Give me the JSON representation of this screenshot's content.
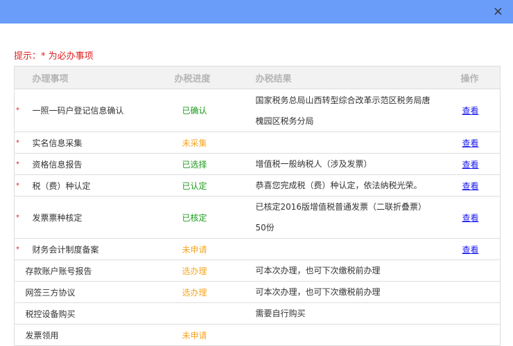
{
  "close_icon": "×",
  "hint": "提示：* 为必办事项",
  "headers": [
    "办理事项",
    "办税进度",
    "办税结果",
    "操作"
  ],
  "rows": [
    {
      "required": "*",
      "item": "一照一码户登记信息确认",
      "status": "已确认",
      "status_color": "green",
      "result": "国家税务总局山西转型综合改革示范区税务局唐槐园区税务分局",
      "action": "查看"
    },
    {
      "required": "*",
      "item": "实名信息采集",
      "status": "未采集",
      "status_color": "orange",
      "result": "",
      "action": "查看"
    },
    {
      "required": "*",
      "item": "资格信息报告",
      "status": "已选择",
      "status_color": "green",
      "result": "增值税一般纳税人（涉及发票）",
      "action": "查看"
    },
    {
      "required": "*",
      "item": "税（费）种认定",
      "status": "已认定",
      "status_color": "green",
      "result": "恭喜您完成税（费）种认定，依法纳税光荣。",
      "action": "查看"
    },
    {
      "required": "*",
      "item": "发票票种核定",
      "status": "已核定",
      "status_color": "green",
      "result": "已核定2016版增值税普通发票（二联折叠票）50份",
      "action": "查看"
    },
    {
      "required": "*",
      "item": "财务会计制度备案",
      "status": "未申请",
      "status_color": "orange",
      "result": "",
      "action": "查看"
    },
    {
      "required": "",
      "item": "存款账户账号报告",
      "status": "选办理",
      "status_color": "orange",
      "result": "可本次办理，也可下次缴税前办理",
      "action": ""
    },
    {
      "required": "",
      "item": "网签三方协议",
      "status": "选办理",
      "status_color": "orange",
      "result": "可本次办理，也可下次缴税前办理",
      "action": ""
    },
    {
      "required": "",
      "item": "税控设备购买",
      "status": "",
      "status_color": "",
      "result": "需要自行购买",
      "action": ""
    },
    {
      "required": "",
      "item": "发票领用",
      "status": "未申请",
      "status_color": "orange",
      "result": "",
      "action": ""
    }
  ]
}
